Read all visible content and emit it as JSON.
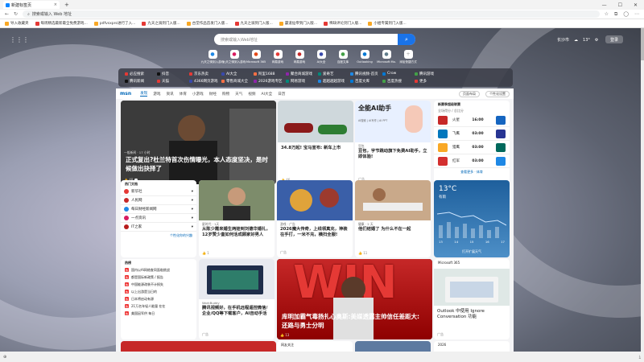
{
  "tab": {
    "title": "新建标签页",
    "close": "×",
    "new": "+"
  },
  "address": {
    "url": "搜索或输入 Web 地址"
  },
  "bookmarks": [
    "导入收藏夹",
    "每周精选最新最全免费游戏...",
    "pdfvsxpro进行了入...",
    "九天之骑到门入版...",
    "古堂作品首发门入版...",
    "九天之骑到门入版...",
    "霸道仙帝到门入版...",
    "稀缺评论到门入版...",
    "小姐专属到门入版..."
  ],
  "search": {
    "placeholder": "搜索或输入Web地址",
    "btn": "⌕"
  },
  "weather_top": {
    "location": "长沙市",
    "temp": "13°",
    "login": "登录"
  },
  "quick": [
    {
      "label": "九天之骑到入游戏",
      "c": "#1e88e5"
    },
    {
      "label": "九天之骑到入游戏",
      "c": "#d81b60"
    },
    {
      "label": "Microsoft 365",
      "c": "#e64a19"
    },
    {
      "label": "网易游戏",
      "c": "#e53935"
    },
    {
      "label": "网易游戏",
      "c": "#c62828"
    },
    {
      "label": "AI大全",
      "c": "#3949ab"
    },
    {
      "label": "百度文库",
      "c": "#43a047"
    },
    {
      "label": "Outlooking",
      "c": "#0078d4"
    },
    {
      "label": "Microsoft Mo.",
      "c": "#607d8b"
    },
    {
      "label": "添加快捷方式",
      "c": "#9e9e9e"
    }
  ],
  "links": [
    [
      "必应搜索",
      "抖音",
      "京东热卖",
      "AI大全",
      "阿里1688",
      "聚合商城游戏",
      "爱奇艺",
      "腾讯视频-首页",
      "Crow",
      "腾讯游戏"
    ],
    [
      "腾讯新闻",
      "天猫",
      "4366网页游戏",
      "零售商城大全",
      "2026游戏专区",
      "网易游戏",
      "超越越越游戏",
      "百度文库",
      "百度热搜",
      "更多"
    ]
  ],
  "feed_tabs": {
    "logo": "msn",
    "items": [
      "发现",
      "游戏",
      "资讯",
      "体育",
      "小游戏",
      "财经",
      "购物",
      "天气",
      "视频",
      "AI大全",
      "日历"
    ],
    "active": "发现",
    "b1": "页面布局",
    "b2": "个性化设置"
  },
  "cards": {
    "lead": {
      "title": "正式复出?杜兰特首次伤情曝光，本人态度坚决，是时候做出抉择了",
      "src": "一般新闻 · 17 小时",
      "meta": "👍 48   💬"
    },
    "car": {
      "title": "34.8万起! 宝马宣布: 新车上市",
      "src": "车讯 · 广告",
      "meta": "👍 46"
    },
    "ai": {
      "brand": "全能AI助手",
      "sub": "AI搜索 | AI写作 | AI PPT",
      "title": "豆包，字节跳动旗下免费AI助手，立即体验!",
      "src": "豆包",
      "meta": "广告"
    },
    "popular": {
      "title": "热门文档",
      "items": [
        "新华社",
        "人民网",
        "每日财经新闻网",
        "一点资讯",
        "IT之家"
      ],
      "more": "个性化你的兴趣"
    },
    "man": {
      "title": "从陈少霞来婚生两娃到刘德华婚礼，12岁赞少皇如何活成顾家好男人",
      "src": "星时代 · 1天",
      "meta": "👍 1"
    },
    "game": {
      "title": "2026魔大传奇，上线领真充，神装在手打，一米不充，横扫全服!",
      "src": "游戏 · 广告",
      "meta": "广告"
    },
    "kitchen": {
      "title": "他们结婚了 为什么不在一起",
      "src": "健康 · 2 天",
      "meta": "👍 11"
    },
    "hot": {
      "title": "热榜",
      "items": [
        "国内以AI网络查同面临挑战",
        "都是国际新政策 / 报告",
        "中国能源改装不计损失",
        "以上出游是当日的",
        "日本将启动有源",
        "21万名年轻人能量 在在",
        "美国因军供 每日"
      ]
    },
    "tech": {
      "title": "腾讯视频好，在手机远程遥控微信/企业/QQ等下载客户，AI自动手活",
      "src": "WorkBuddy",
      "meta": "广告"
    },
    "win": {
      "big": "WIN",
      "title": "库明加霸气毒扬扎心奥斯:美媒透露主帅信任差距大: 还路与勇士分明",
      "src": "体育中 · 1 小时",
      "meta": "👍 13"
    },
    "ms": {
      "hdr": "Microsoft 365",
      "title": "Outlook 中使用 Ignore Conversation 功能",
      "meta": "广告"
    },
    "bottom": [
      "",
      "网友关注",
      "",
      "",
      "2026"
    ]
  },
  "sports": {
    "title": "新赛季超级联赛",
    "sub": "全场得分 / 总比分",
    "rows": [
      [
        "火星",
        "16:00",
        "东方"
      ],
      [
        "飞鹰",
        "03:00",
        "英雄"
      ],
      [
        "猎鹰",
        "03:00",
        "巨人"
      ],
      [
        "红军",
        "03:00",
        "蓝队"
      ]
    ],
    "more": "查看更多 · 体育"
  },
  "weather": {
    "temp": "13°C",
    "label": "有雨",
    "hrs": [
      "13",
      "14",
      "15",
      "16",
      "17"
    ],
    "more": "打开扩展天气"
  }
}
